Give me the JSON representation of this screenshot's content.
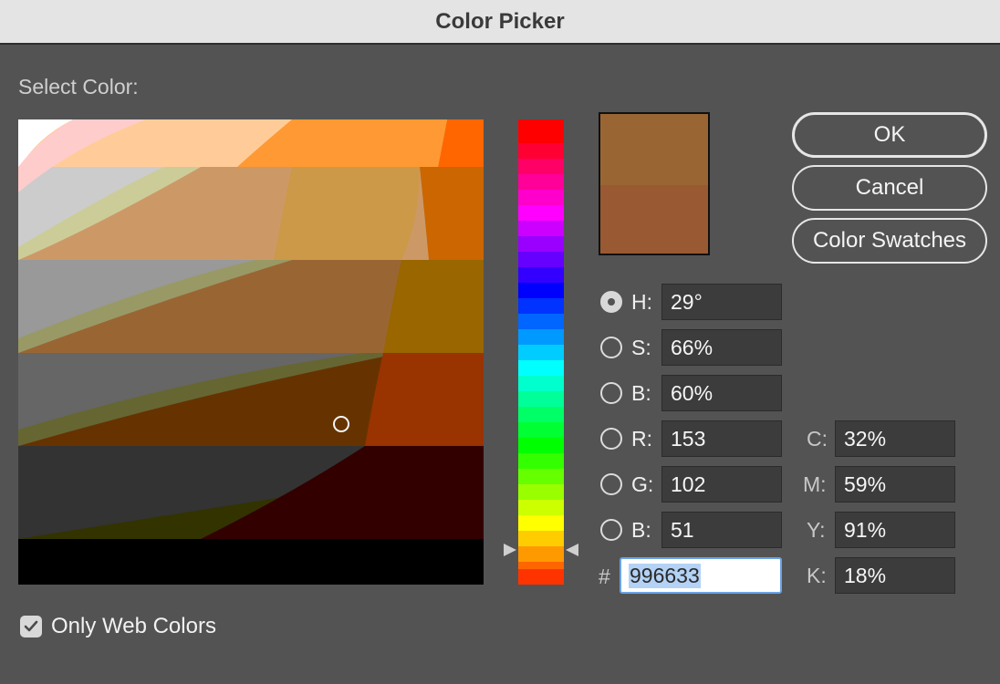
{
  "window": {
    "title": "Color Picker"
  },
  "select_color_label": "Select Color:",
  "colors": {
    "new": "#996633",
    "current": "#995a33"
  },
  "buttons": {
    "ok": "OK",
    "cancel": "Cancel",
    "swatches": "Color Swatches"
  },
  "hsb": [
    {
      "label": "H:",
      "value": "29°",
      "selected": true
    },
    {
      "label": "S:",
      "value": "66%",
      "selected": false
    },
    {
      "label": "B:",
      "value": "60%",
      "selected": false
    }
  ],
  "rgb": [
    {
      "label": "R:",
      "value": "153"
    },
    {
      "label": "G:",
      "value": "102"
    },
    {
      "label": "B:",
      "value": "51"
    }
  ],
  "cmyk": [
    {
      "label": "C:",
      "value": "32%"
    },
    {
      "label": "M:",
      "value": "59%"
    },
    {
      "label": "Y:",
      "value": "91%"
    },
    {
      "label": "K:",
      "value": "18%"
    }
  ],
  "hex": {
    "prefix": "#",
    "value": "996633"
  },
  "only_web_colors": {
    "label": "Only Web Colors",
    "checked": true
  }
}
